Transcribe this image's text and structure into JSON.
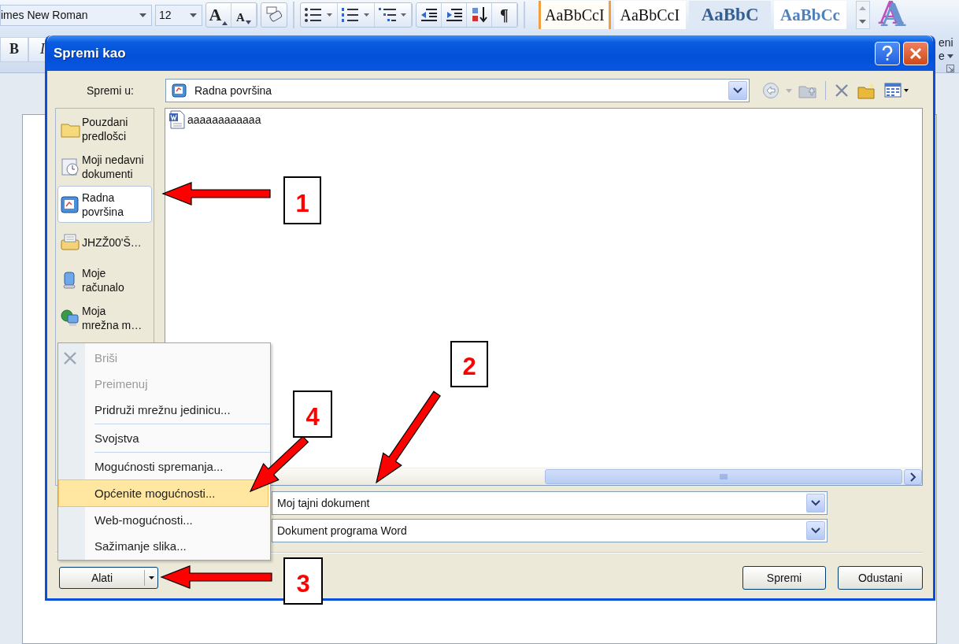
{
  "ribbon": {
    "font": "imes New Roman",
    "size": "12",
    "grow_font": "A",
    "shrink_font": "A",
    "bold": "B",
    "italic": "I",
    "pilcrow": "¶",
    "styles": [
      {
        "sample": "AaBbCcI",
        "kind": "normal",
        "selected": true
      },
      {
        "sample": "AaBbCcI",
        "kind": "normal",
        "selected": false
      },
      {
        "sample": "AaBbC",
        "kind": "heading1",
        "selected": false
      },
      {
        "sample": "AaBbCc",
        "kind": "heading2",
        "selected": false
      }
    ],
    "change_styles": {
      "glyph": "A",
      "label_lines": [
        "eni",
        "e"
      ]
    }
  },
  "dialog": {
    "title": "Spremi kao",
    "save_in_label": "Spremi u:",
    "location": "Radna površina",
    "places": [
      {
        "label": "Pouzdani\npredlošci",
        "kind": "folder",
        "selected": false
      },
      {
        "label": "Moji nedavni\ndokumenti",
        "kind": "recent",
        "selected": false
      },
      {
        "label": "Radna\npovršina",
        "kind": "desktop",
        "selected": true
      },
      {
        "label": "JHZŽ00'Š…",
        "kind": "drive",
        "selected": false
      },
      {
        "label": "Moje\nračunalo",
        "kind": "computer",
        "selected": false
      },
      {
        "label": "Moja\nmrežna m…",
        "kind": "network",
        "selected": false
      }
    ],
    "files": [
      {
        "name": "aaaaaaaaaaaa"
      }
    ],
    "file_name": "Moj tajni dokument",
    "file_type": "Dokument programa Word",
    "tools_button": "Alati",
    "save_button": "Spremi",
    "cancel_button": "Odustani"
  },
  "tools_menu": [
    {
      "kind": "item",
      "label": "Briši",
      "disabled": true,
      "selected": false
    },
    {
      "kind": "item",
      "label": "Preimenuj",
      "disabled": true,
      "selected": false
    },
    {
      "kind": "item",
      "label": "Pridruži mrežnu jedinicu...",
      "disabled": false,
      "selected": false
    },
    {
      "kind": "separator"
    },
    {
      "kind": "item",
      "label": "Svojstva",
      "disabled": false,
      "selected": false
    },
    {
      "kind": "separator"
    },
    {
      "kind": "item",
      "label": "Mogućnosti spremanja...",
      "disabled": false,
      "selected": false
    },
    {
      "kind": "item",
      "label": "Općenite mogućnosti...",
      "disabled": false,
      "selected": true
    },
    {
      "kind": "item",
      "label": "Web-mogućnosti...",
      "disabled": false,
      "selected": false
    },
    {
      "kind": "item",
      "label": "Sažimanje slika...",
      "disabled": false,
      "selected": false
    }
  ],
  "callouts": [
    {
      "number": "1"
    },
    {
      "number": "2"
    },
    {
      "number": "3"
    },
    {
      "number": "4"
    }
  ]
}
